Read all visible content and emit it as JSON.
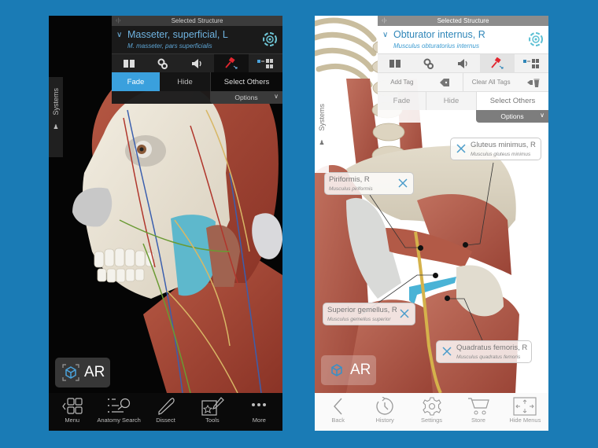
{
  "background_color": "#1a7bb5",
  "left_phone": {
    "theme": "dark",
    "panel": {
      "title": "Selected Structure",
      "nav_arrows": "‹|›",
      "structure_name": "Masseter, superficial, L",
      "latin_name": "M. masseter, pars superficialis",
      "icons": [
        "book-icon",
        "stethoscope-icon",
        "speaker-icon",
        "pin-tool-icon",
        "isolate-icon"
      ],
      "actions": {
        "fade": "Fade",
        "hide": "Hide",
        "select_others": "Select Others"
      },
      "active_action": "Fade",
      "options": "Options"
    },
    "systems_tab": "Systems",
    "ar_button": "AR",
    "bottom_bar": [
      {
        "icon": "menu-grid-icon",
        "label": "Menu"
      },
      {
        "icon": "anatomy-search-icon",
        "label": "Anatomy Search"
      },
      {
        "icon": "scalpel-icon",
        "label": "Dissect"
      },
      {
        "icon": "tools-icon",
        "label": "Tools"
      },
      {
        "icon": "more-icon",
        "label": "More"
      }
    ],
    "accent_color": "#3aa0dd"
  },
  "right_phone": {
    "theme": "light",
    "panel": {
      "title": "Selected Structure",
      "nav_arrows": "‹|›",
      "structure_name": "Obturator internus, R",
      "latin_name": "Musculus obturatorius internus",
      "icons": [
        "book-icon",
        "stethoscope-icon",
        "speaker-icon",
        "pin-tool-icon",
        "isolate-icon"
      ],
      "tags": {
        "add": "Add Tag",
        "clear": "Clear All Tags"
      },
      "actions": {
        "fade": "Fade",
        "hide": "Hide",
        "select_others": "Select Others"
      },
      "options": "Options"
    },
    "systems_tab": "Systems",
    "ar_button": "AR",
    "callouts": [
      {
        "name": "Gluteus minimus, R",
        "latin": "Musculus gluteus minimus"
      },
      {
        "name": "Piriformis, R",
        "latin": "Musculus piriformis"
      },
      {
        "name": "Superior gemellus, R",
        "latin": "Musculus gemellus superior"
      },
      {
        "name": "Quadratus femoris, R",
        "latin": "Musculus quadratus femoris"
      }
    ],
    "bottom_bar": [
      {
        "icon": "back-icon",
        "label": "Back"
      },
      {
        "icon": "history-icon",
        "label": "History"
      },
      {
        "icon": "settings-icon",
        "label": "Settings"
      },
      {
        "icon": "store-cart-icon",
        "label": "Store"
      },
      {
        "icon": "hide-menus-icon",
        "label": "Hide Menus"
      }
    ],
    "accent_color": "#2f86b8"
  }
}
